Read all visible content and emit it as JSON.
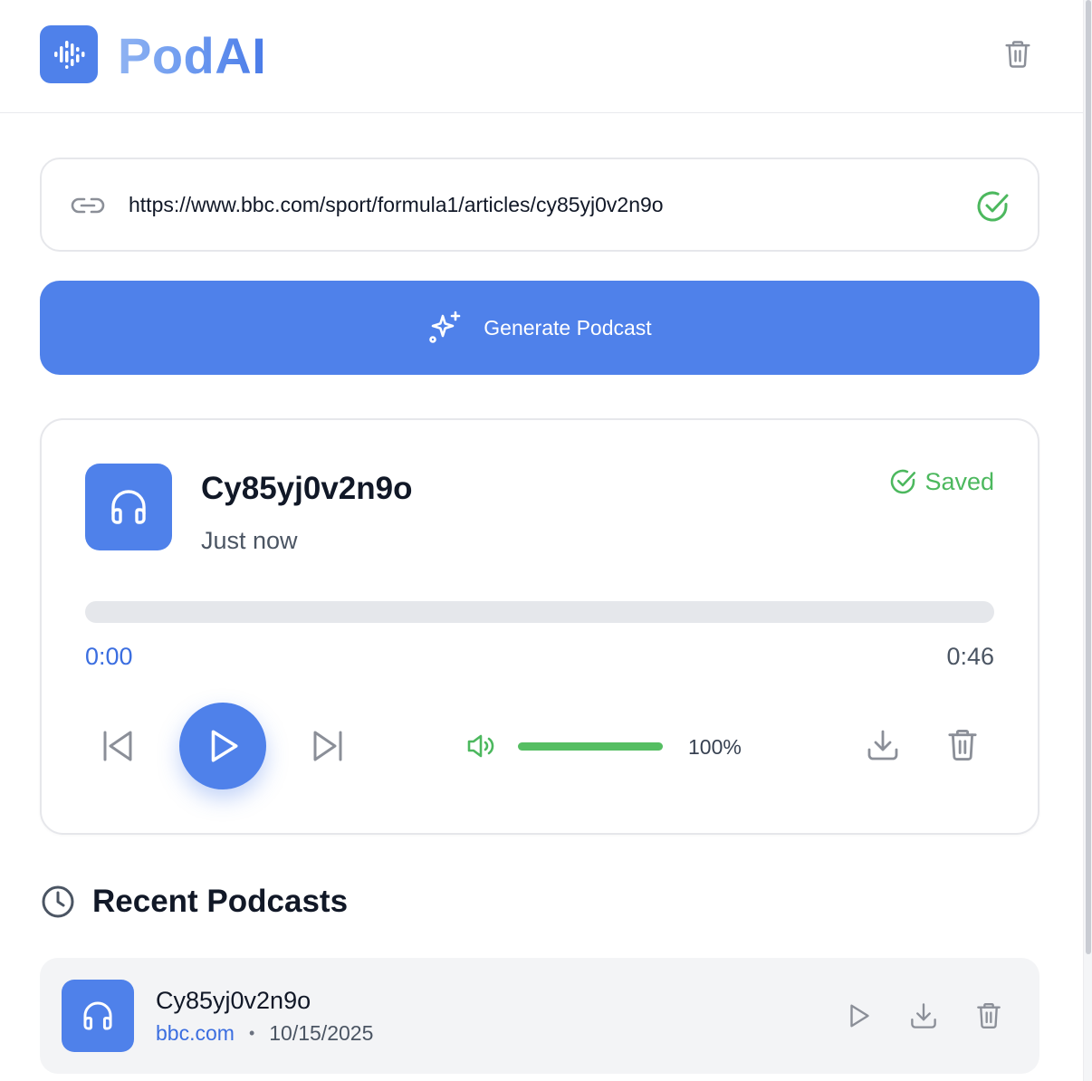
{
  "app": {
    "name": "PodAI",
    "accent_color": "#4f81ea",
    "success_color": "#4cb85e"
  },
  "header": {
    "logo_icon": "waveform-icon",
    "clear_icon": "trash-icon"
  },
  "url_input": {
    "value": "https://www.bbc.com/sport/formula1/articles/cy85yj0v2n9o",
    "link_icon": "link-icon",
    "status_icon": "check-circle-icon"
  },
  "generate": {
    "label": "Generate Podcast",
    "icon": "sparkles-icon"
  },
  "player": {
    "title": "Cy85yj0v2n9o",
    "subtitle": "Just now",
    "saved_label": "Saved",
    "current_time": "0:00",
    "duration": "0:46",
    "progress": 0,
    "volume_label": "100%",
    "volume": 1.0,
    "icons": [
      "headphones-icon",
      "skip-back-icon",
      "play-icon",
      "skip-forward-icon",
      "volume-icon",
      "download-icon",
      "trash-icon"
    ]
  },
  "recent": {
    "heading": "Recent Podcasts",
    "heading_icon": "clock-icon",
    "items": [
      {
        "title": "Cy85yj0v2n9o",
        "domain": "bbc.com",
        "separator": "•",
        "date": "10/15/2025"
      }
    ]
  }
}
